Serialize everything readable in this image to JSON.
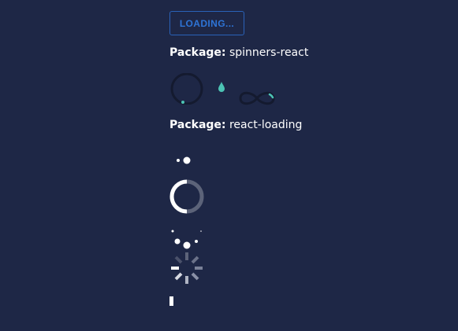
{
  "button": {
    "label": "LOADING..."
  },
  "packages": [
    {
      "label": "Package:",
      "name": "spinners-react"
    },
    {
      "label": "Package:",
      "name": "react-loading"
    }
  ],
  "colors": {
    "background": "#1e2746",
    "button_border": "#2a62b8",
    "button_text": "#2e74d6",
    "spinner_dark": "#141a2f",
    "spinner_accent": "#4cc3b4",
    "loader_white": "#ffffff",
    "loader_gray": "#5c6379"
  },
  "icons": {
    "spinners_react": [
      "circular-spinner-icon",
      "droplet-spinner-icon",
      "infinity-spinner-icon"
    ],
    "react_loading": [
      "bubbles-loader-icon",
      "spin-loader-icon",
      "spinning-bubbles-loader-icon",
      "spokes-loader-icon",
      "bars-loader-icon"
    ]
  }
}
